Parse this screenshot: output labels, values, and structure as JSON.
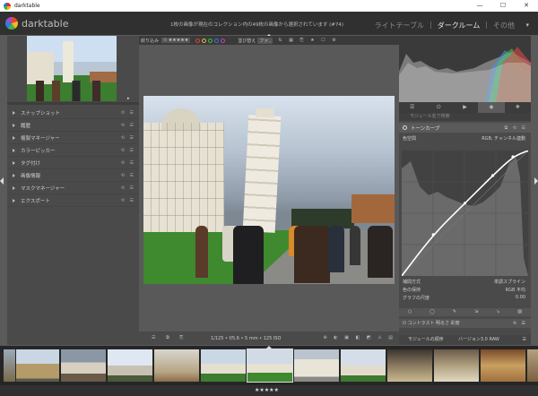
{
  "window": {
    "title": "darktable",
    "controls": [
      "—",
      "☐",
      "✕"
    ]
  },
  "header": {
    "brand": "darktable",
    "info": "1枚の画像が現在のコレクション内の49枚の画像から選択されています (#74)",
    "views": [
      "ライトテーブル",
      "ダークルーム",
      "その他"
    ],
    "active_view": "ダークルーム",
    "menu": "▾"
  },
  "toolbar": {
    "filter_label": "絞り込み",
    "stars": "✩ ★★★★★",
    "color_labels": [
      "#e04040",
      "#e0c040",
      "#40c040",
      "#4070e0",
      "#c040c0"
    ],
    "sort_label": "並び替え",
    "sort_value": "ファ.."
  },
  "left_panel": {
    "zoom_label": "▸",
    "modules": [
      {
        "label": "スナップショット"
      },
      {
        "label": "履歴"
      },
      {
        "label": "複製マネージャー"
      },
      {
        "label": "カラーピッカー"
      },
      {
        "label": "タグ付け"
      },
      {
        "label": "画像情報"
      },
      {
        "label": "マスクマネージャー"
      },
      {
        "label": "エクスポート"
      }
    ]
  },
  "bottom_bar": {
    "exif": "1/125 • f/5.6 • 5 mm • 125 ISO"
  },
  "right_panel": {
    "tabs": [
      "☰",
      "⏻",
      "▶",
      "◉",
      "❖"
    ],
    "active_tab_index": 3,
    "search_placeholder": "モジュール名で検索",
    "tone_curve": {
      "title": "トーンカーブ",
      "color_space_label": "色空間",
      "color_space_value": "RGB, チャンネル連動",
      "interp_label": "補間方式",
      "interp_value": "単調スプライン",
      "preserve_label": "色の保持",
      "preserve_value": "RGB 平均",
      "scale_label": "グラフの尺度",
      "scale_value": "0.00",
      "curve_points": [
        [
          0,
          0
        ],
        [
          0.25,
          0.33
        ],
        [
          0.5,
          0.58
        ],
        [
          0.72,
          0.8
        ],
        [
          0.88,
          0.95
        ],
        [
          1,
          1
        ]
      ]
    },
    "contrast_module": "コントラスト 明るさ 彩度",
    "bottom_label": "モジュールの順序",
    "bottom_value": "バージョン3.0 RAW"
  },
  "filmstrip": {
    "rating": "★★★★★"
  }
}
